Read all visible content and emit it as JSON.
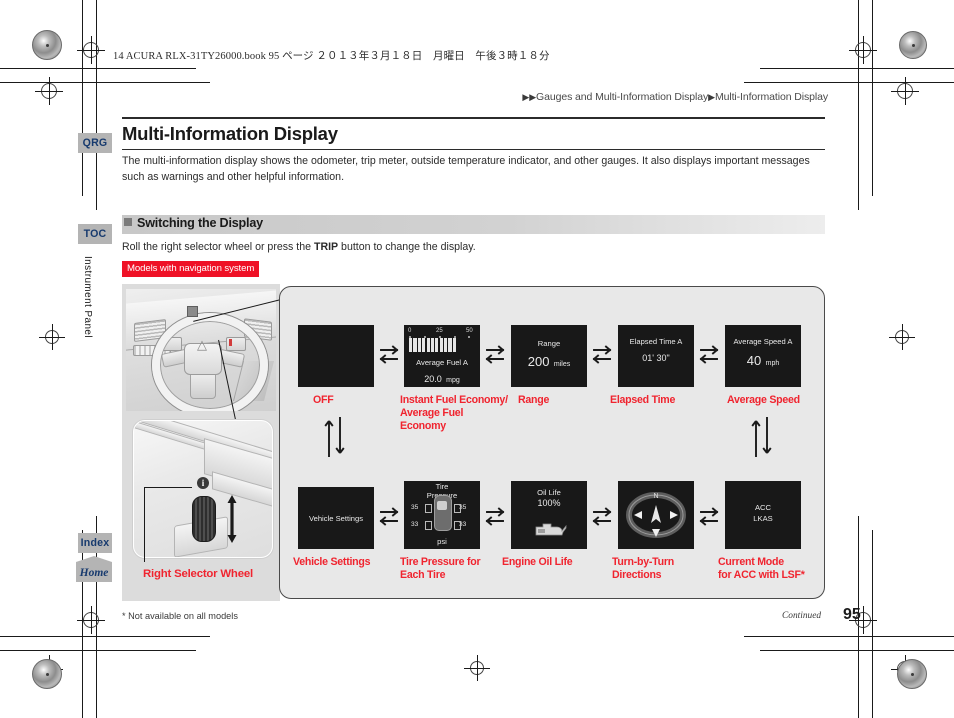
{
  "print_header": "14 ACURA RLX-31TY26000.book  95 ページ  ２０１３年３月１８日　月曜日　午後３時１８分",
  "breadcrumb": {
    "part1": "Gauges and Multi-Information Display",
    "part2": "Multi-Information Display",
    "marker": "▶"
  },
  "page": {
    "title": "Multi-Information Display",
    "intro": "The multi-information display shows the odometer, trip meter, outside temperature indicator, and other gauges. It also displays important messages such as warnings and other helpful information.",
    "section_heading": "Switching the Display",
    "instruction_pre": "Roll the right selector wheel or press the ",
    "instruction_bold": "TRIP",
    "instruction_post": " button to change the display.",
    "badge": "Models with navigation system",
    "footnote": "* Not available on all models",
    "continued": "Continued",
    "page_number": "95"
  },
  "sidebar": {
    "tabs": [
      {
        "label": "QRG"
      },
      {
        "label": "TOC"
      },
      {
        "label": "Index"
      },
      {
        "label": "Home"
      }
    ],
    "vertical_label": "Instrument Panel"
  },
  "figure": {
    "selector_wheel_label": "Right Selector Wheel",
    "info_icon": "i",
    "row1": [
      {
        "id": "off",
        "label": "OFF",
        "screen": {
          "kind": "blank"
        }
      },
      {
        "id": "fuel-economy",
        "label": "Instant Fuel Economy/\nAverage Fuel Economy",
        "screen": {
          "kind": "fuel",
          "scale_ticks": [
            "0",
            "25",
            "50"
          ],
          "title": "Average Fuel A",
          "value": "20.0",
          "unit": "mpg",
          "bar_count": 11
        }
      },
      {
        "id": "range",
        "label": "Range",
        "screen": {
          "kind": "value",
          "title": "Range",
          "value": "200",
          "unit": "miles"
        }
      },
      {
        "id": "elapsed-time",
        "label": "Elapsed Time",
        "screen": {
          "kind": "value",
          "title": "Elapsed Time A",
          "value": "01' 30\"",
          "unit": ""
        }
      },
      {
        "id": "average-speed",
        "label": "Average Speed",
        "screen": {
          "kind": "value",
          "title": "Average Speed A",
          "value": "40",
          "unit": "mph"
        }
      }
    ],
    "row2": [
      {
        "id": "vehicle-settings",
        "label": "Vehicle Settings",
        "screen": {
          "kind": "center",
          "title": "Vehicle Settings"
        }
      },
      {
        "id": "tire-pressure",
        "label": "Tire Pressure for\nEach Tire",
        "screen": {
          "kind": "tire",
          "title_line1": "Tire",
          "title_line2": "Pressure",
          "front_left": "35",
          "front_right": "35",
          "rear_left": "33",
          "rear_right": "33",
          "unit": "psi"
        }
      },
      {
        "id": "engine-oil-life",
        "label": "Engine Oil Life",
        "screen": {
          "kind": "oil",
          "title": "Oil Life",
          "value": "100%"
        }
      },
      {
        "id": "turn-by-turn",
        "label": "Turn-by-Turn\nDirections",
        "screen": {
          "kind": "compass",
          "north": "N"
        }
      },
      {
        "id": "acc-lkas",
        "label": "Current Mode\nfor ACC with LSF*",
        "screen": {
          "kind": "twoline",
          "line1": "ACC",
          "line2": "LKAS"
        }
      }
    ]
  },
  "colors": {
    "red_label": "#f0242f",
    "badge_red": "#ef1126",
    "tab_bg": "#b4b4b4",
    "tab_text": "#173a6e",
    "screen_bg": "#181818"
  }
}
